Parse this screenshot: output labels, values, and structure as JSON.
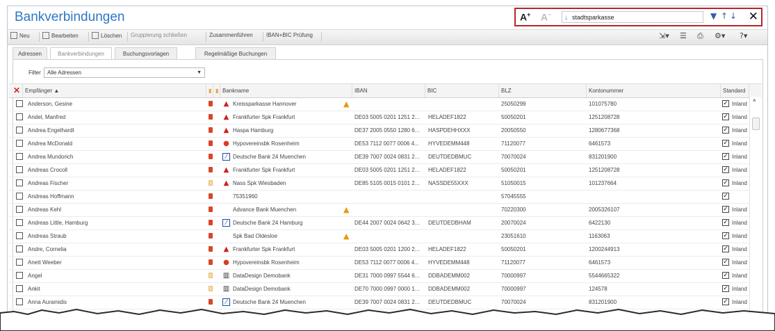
{
  "title": "Bankverbindungen",
  "search": {
    "font_larger": "A",
    "font_smaller": "A",
    "value": "stadtsparkasse",
    "icons": [
      "filter-icon",
      "sort-asc-icon",
      "sort-desc-icon",
      "close-icon"
    ]
  },
  "toolbar": {
    "new": "Neu",
    "edit": "Bearbeiten",
    "delete": "Löschen",
    "ungroup": "Gruppierung schließen",
    "merge": "Zusammenführen",
    "iban_check": "IBAN+BIC Prüfung"
  },
  "tabs": [
    "Adressen",
    "Bankverbindungen",
    "Buchungsvorlagen",
    "Regelmäßige Buchungen"
  ],
  "filter": {
    "label": "Filter",
    "value": "Alle Adressen"
  },
  "columns": {
    "recipient": "Empfänger ▲",
    "bankname": "Bankname",
    "iban": "IBAN",
    "bic": "BIC",
    "blz": "BLZ",
    "account": "Kontonummer",
    "standard": "Standard"
  },
  "rows": [
    {
      "name": "Anderson, Gesine",
      "lock": "red",
      "bankicon": "sparkasse",
      "bank": "Kreissparkasse Hannover",
      "iban": "",
      "bic": "",
      "warn": true,
      "blz": "25050299",
      "account": "101075780",
      "checked": true,
      "std": "Inland"
    },
    {
      "name": "Andel, Manfred",
      "lock": "red",
      "bankicon": "sparkasse",
      "bank": "Frankfurter Spk Frankfurt",
      "iban": "DE03 5005 0201 1251 2...",
      "bic": "HELADEF1822",
      "warn": false,
      "blz": "50050201",
      "account": "1251208728",
      "checked": true,
      "std": "Inland"
    },
    {
      "name": "Andrea Engelhardt",
      "lock": "red",
      "bankicon": "sparkasse",
      "bank": "Haspa Hamburg",
      "iban": "DE37 2005 0550 1280 6...",
      "bic": "HASPDEHHXXX",
      "warn": false,
      "blz": "20050550",
      "account": "1280677368",
      "checked": true,
      "std": "Inland"
    },
    {
      "name": "Andrea McDonald",
      "lock": "red",
      "bankicon": "hypo",
      "bank": "Hypovereinsbk Rosenheim",
      "iban": "DE53 7112 0077 0006 4...",
      "bic": "HYVEDEMM448",
      "warn": false,
      "blz": "71120077",
      "account": "6461573",
      "checked": true,
      "std": "Inland"
    },
    {
      "name": "Andrea Mundorich",
      "lock": "red",
      "bankicon": "deutsche",
      "bank": "Deutsche Bank 24 Muenchen",
      "iban": "DE39 7007 0024 0831 2...",
      "bic": "DEUTDEDBMUC",
      "warn": false,
      "blz": "70070024",
      "account": "831201900",
      "checked": true,
      "std": "Inland"
    },
    {
      "name": "Andreas Crocoll",
      "lock": "red",
      "bankicon": "sparkasse",
      "bank": "Frankfurter Spk Frankfurt",
      "iban": "DE03 5005 0201 1251 2...",
      "bic": "HELADEF1822",
      "warn": false,
      "blz": "50050201",
      "account": "1251208728",
      "checked": true,
      "std": "Inland"
    },
    {
      "name": "Andreas Fischer",
      "lock": "pale",
      "bankicon": "sparkasse",
      "bank": "Nass Spk Wiesbaden",
      "iban": "DE85 5105 0015 0101 2...",
      "bic": "NASSDE55XXX",
      "warn": false,
      "blz": "51050015",
      "account": "101237664",
      "checked": true,
      "std": "Inland"
    },
    {
      "name": "Andreas Hoffmann",
      "lock": "red",
      "bankicon": "",
      "bank": "75351960",
      "iban": "",
      "bic": "",
      "warn": false,
      "blz": "57045555",
      "account": "",
      "checked": true,
      "std": ""
    },
    {
      "name": "Andreas Kehl",
      "lock": "red",
      "bankicon": "",
      "bank": "Advance Bank Muenchen",
      "iban": "",
      "bic": "",
      "warn": true,
      "blz": "70220300",
      "account": "2005326107",
      "checked": true,
      "std": "Inland"
    },
    {
      "name": "Andreas Little, Hamburg",
      "lock": "red",
      "bankicon": "deutsche",
      "bank": "Deutsche Bank 24 Hamburg",
      "iban": "DE44 2007 0024 0642 3...",
      "bic": "DEUTDEDBHAM",
      "warn": false,
      "blz": "20070024",
      "account": "6422130",
      "checked": true,
      "std": "Inland"
    },
    {
      "name": "Andreas Straub",
      "lock": "red",
      "bankicon": "",
      "bank": "Spk Bad Oldesloe",
      "iban": "",
      "bic": "",
      "warn": true,
      "blz": "23051610",
      "account": "1163063",
      "checked": true,
      "std": "Inland"
    },
    {
      "name": "Andre, Cornelia",
      "lock": "red",
      "bankicon": "sparkasse",
      "bank": "Frankfurter Spk Frankfurt",
      "iban": "DE03 5005 0201 1200 2...",
      "bic": "HELADEF1822",
      "warn": false,
      "blz": "50050201",
      "account": "1200244913",
      "checked": true,
      "std": "Inland"
    },
    {
      "name": "Anett Weeber",
      "lock": "red",
      "bankicon": "hypo",
      "bank": "Hypovereinsbk Rosenheim",
      "iban": "DE53 7112 0077 0006 4...",
      "bic": "HYVEDEMM448",
      "warn": false,
      "blz": "71120077",
      "account": "6461573",
      "checked": true,
      "std": "Inland"
    },
    {
      "name": "Angel",
      "lock": "pale",
      "bankicon": "bank",
      "bank": "DataDesign Demobank",
      "iban": "DE31 7000 0997 5544 6...",
      "bic": "DDBADEMM002",
      "warn": false,
      "blz": "70000997",
      "account": "5544665322",
      "checked": true,
      "std": "Inland"
    },
    {
      "name": "Ankit",
      "lock": "pale",
      "bankicon": "bank",
      "bank": "DataDesign Demobank",
      "iban": "DE70 7000 0997 0000 1...",
      "bic": "DDBADEMM002",
      "warn": false,
      "blz": "70000997",
      "account": "124578",
      "checked": true,
      "std": "Inland"
    },
    {
      "name": "Anna Auramidis",
      "lock": "red",
      "bankicon": "deutsche",
      "bank": "Deutsche Bank 24 Muenchen",
      "iban": "DE39 7007 0024 0831 2...",
      "bic": "DEUTDEDBMUC",
      "warn": false,
      "blz": "70070024",
      "account": "831201900",
      "checked": true,
      "std": "Inland"
    }
  ]
}
